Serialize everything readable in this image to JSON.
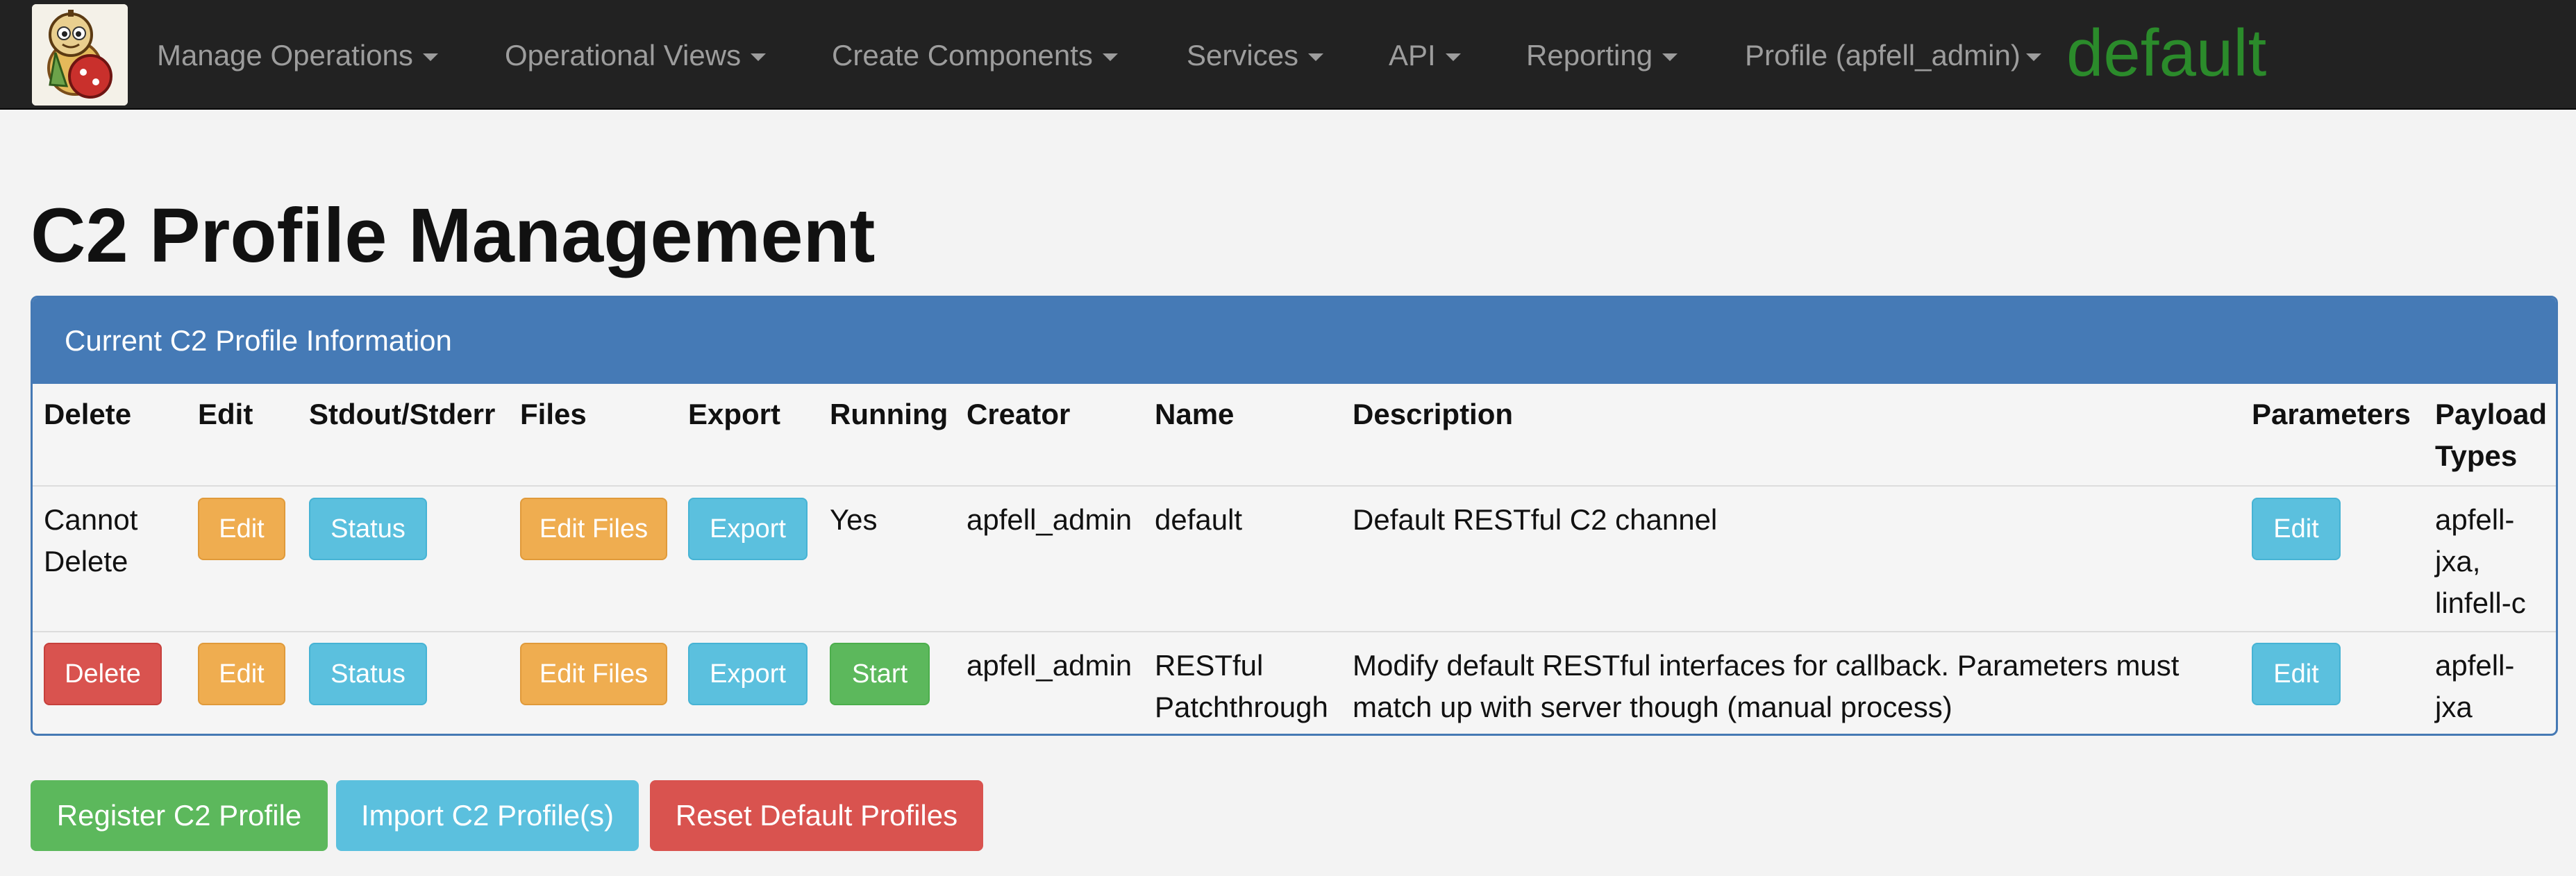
{
  "navbar": {
    "items": [
      {
        "label": "Manage Operations"
      },
      {
        "label": "Operational Views"
      },
      {
        "label": "Create Components"
      },
      {
        "label": "Services"
      },
      {
        "label": "API"
      },
      {
        "label": "Reporting"
      },
      {
        "label": "Profile (apfell_admin)"
      }
    ],
    "current_operation": "default"
  },
  "page": {
    "title": "C2 Profile Management"
  },
  "panel": {
    "heading": "Current C2 Profile Information"
  },
  "table": {
    "headers": [
      "Delete",
      "Edit",
      "Stdout/Stderr",
      "Files",
      "Export",
      "Running",
      "Creator",
      "Name",
      "Description",
      "Parameters",
      "Payload Types"
    ],
    "rows": [
      {
        "delete_text": "Cannot Delete",
        "edit_label": "Edit",
        "status_label": "Status",
        "files_label": "Edit Files",
        "export_label": "Export",
        "running": "Yes",
        "creator": "apfell_admin",
        "name": "default",
        "description": "Default RESTful C2 channel",
        "parameters_label": "Edit",
        "payload_types": "apfell-jxa, linfell-c"
      },
      {
        "delete_label": "Delete",
        "edit_label": "Edit",
        "status_label": "Status",
        "files_label": "Edit Files",
        "export_label": "Export",
        "running_button": "Start",
        "creator": "apfell_admin",
        "name": "RESTful Patchthrough",
        "description": "Modify default RESTful interfaces for callback. Parameters must match up with server though (manual process)",
        "parameters_label": "Edit",
        "payload_types": "apfell-jxa"
      }
    ]
  },
  "actions": {
    "register": "Register C2 Profile",
    "import": "Import C2 Profile(s)",
    "reset": "Reset Default Profiles"
  },
  "colors": {
    "navbar_bg": "#222222",
    "panel_heading": "#457ab6",
    "warning": "#efad50",
    "info": "#5bc0de",
    "danger": "#d9534f",
    "success": "#5cb85c",
    "operation_name": "#2b8b2b"
  },
  "icons": {
    "logo": "apfell-logo-icon",
    "dropdown": "caret-down-icon"
  }
}
